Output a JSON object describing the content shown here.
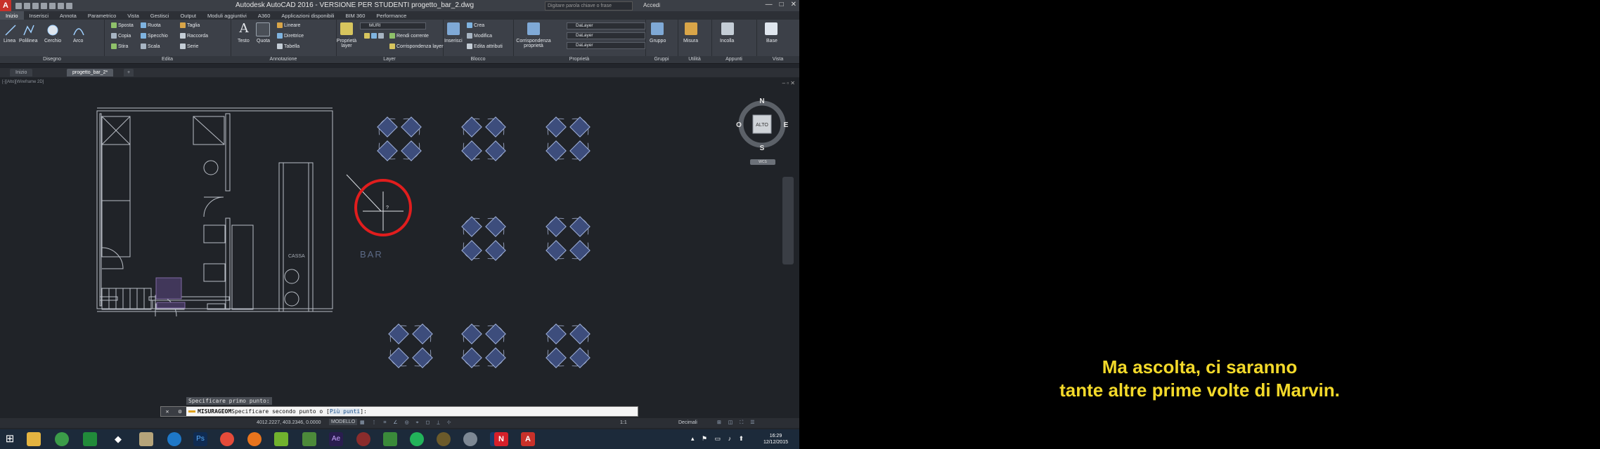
{
  "window": {
    "app_logo": "A",
    "title": "Autodesk AutoCAD 2016 - VERSIONE PER STUDENTI    progetto_bar_2.dwg",
    "search_placeholder": "Digitare parola chiave o frase",
    "user": "Accedi",
    "minimize": "—",
    "maximize": "□",
    "close": "✕"
  },
  "ribbon_tabs": [
    "Inizio",
    "Inserisci",
    "Annota",
    "Parametrico",
    "Vista",
    "Gestisci",
    "Output",
    "Moduli aggiuntivi",
    "A360",
    "Applicazioni disponibili",
    "BIM 360",
    "Performance"
  ],
  "ribbon": {
    "draw": {
      "title": "Disegno",
      "linea": "Linea",
      "polilinea": "Polilinea",
      "cerchio": "Cerchio",
      "arco": "Arco"
    },
    "modify": {
      "title": "Edita",
      "items": [
        "Sposta",
        "Ruota",
        "Taglia",
        "Copia",
        "Specchio",
        "Raccorda",
        "Stira",
        "Scala",
        "Serie"
      ]
    },
    "annotation": {
      "title": "Annotazione",
      "testo": "Testo",
      "quota": "Quota",
      "items": [
        "Lineare",
        "Direttrice",
        "Tabella"
      ]
    },
    "layers": {
      "title": "Layer",
      "proprieta_layer": "Proprietà layer",
      "layer_name": "MURI",
      "items": [
        "Rendi corrente",
        "Corrispondenza layer"
      ]
    },
    "block": {
      "title": "Blocco",
      "inserisci": "Inserisci",
      "items": [
        "Crea",
        "Modifica",
        "Edita attributi"
      ]
    },
    "properties": {
      "title": "Proprietà",
      "corrispondenza": "Corrispondenza proprietà",
      "combos": [
        "DaLayer",
        "DaLayer",
        "DaLayer"
      ]
    },
    "groups": {
      "title": "Gruppi",
      "label": "Gruppo"
    },
    "utilities": {
      "title": "Utilità",
      "label": "Misura"
    },
    "clipboard": {
      "title": "Appunti",
      "label": "Incolla"
    },
    "view": {
      "title": "Vista",
      "label": "Base"
    }
  },
  "doc_tabs": {
    "start": "Inizio",
    "active": "progetto_bar_2*"
  },
  "viewport": {
    "label": "[-][Alto][Wireframe 2D]",
    "viewcube": {
      "n": "N",
      "s": "S",
      "e": "E",
      "w": "O",
      "face": "ALTO",
      "wcs": "WCS"
    },
    "labels": {
      "bar": "BAR",
      "cassa": "CASSA"
    },
    "cursor_tooltip": "?"
  },
  "command": {
    "history": "Specificare primo punto:",
    "command_name": "MISURAGEOM",
    "prompt_text": " Specificare secondo punto o [",
    "option": "Più punti",
    "prompt_end": "]:"
  },
  "status": {
    "coords": "4012.2227, 403.2346, 0.0000",
    "model": "MODELLO",
    "units": "Decimali",
    "scale": "1:1"
  },
  "clock": {
    "time": "16:29",
    "date": "12/12/2015"
  },
  "subtitles": {
    "line1": "Ma ascolta, ci saranno",
    "line2": "tante altre prime volte di Marvin."
  },
  "colors": {
    "accent": "#f3d92a",
    "autocad_red": "#c8312a",
    "background": "#202328",
    "cursor_circle": "#e11d1d"
  }
}
